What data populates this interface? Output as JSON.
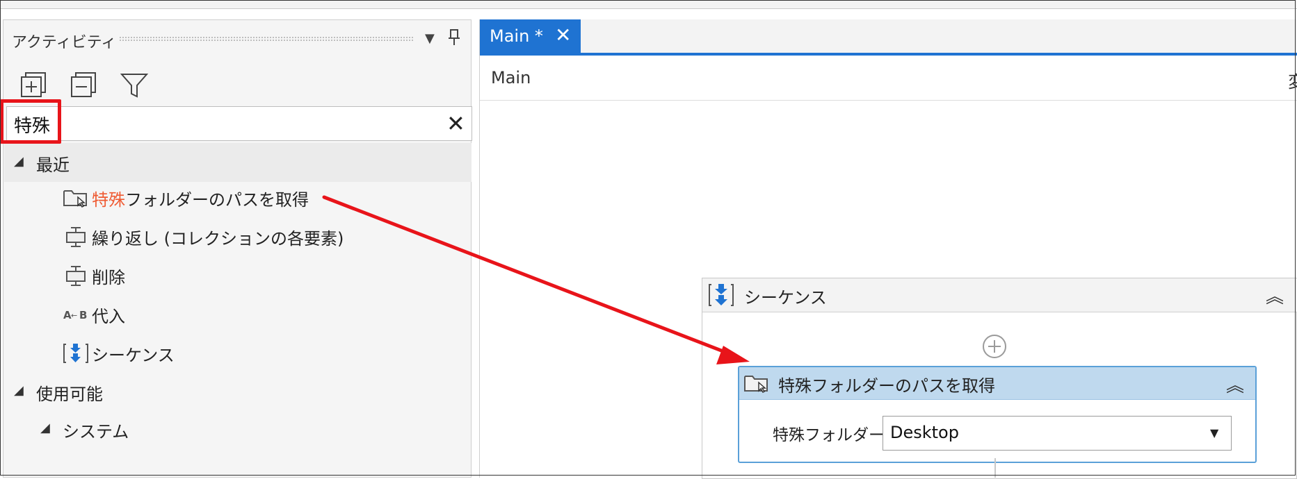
{
  "activities_panel": {
    "title": "アクティビティ",
    "search": {
      "value": "特殊",
      "placeholder": ""
    },
    "groups": [
      {
        "label": "最近"
      },
      {
        "label": "使用可能"
      }
    ],
    "recent_items": [
      {
        "match": "特殊",
        "rest": "フォルダーのパスを取得",
        "icon": "folder-icon"
      },
      {
        "label": "繰り返し (コレクションの各要素)",
        "icon": "loop-icon"
      },
      {
        "label": "削除",
        "icon": "delete-icon"
      },
      {
        "label": "代入",
        "icon": "assign-icon"
      },
      {
        "label": "シーケンス",
        "icon": "sequence-icon"
      }
    ],
    "subgroup": {
      "label": "システム"
    }
  },
  "designer": {
    "tab": {
      "label": "Main *"
    },
    "breadcrumb": "Main",
    "right_cut_text": "変",
    "sequence": {
      "title": "シーケンス"
    },
    "activity": {
      "title": "特殊フォルダーのパスを取得",
      "property_label": "特殊フォルダー",
      "property_value": "Desktop"
    }
  },
  "colors": {
    "accent": "#1f73d2",
    "highlight": "#ef5a32",
    "annotation": "#e8141a",
    "selected_header": "#bfd9ee"
  }
}
